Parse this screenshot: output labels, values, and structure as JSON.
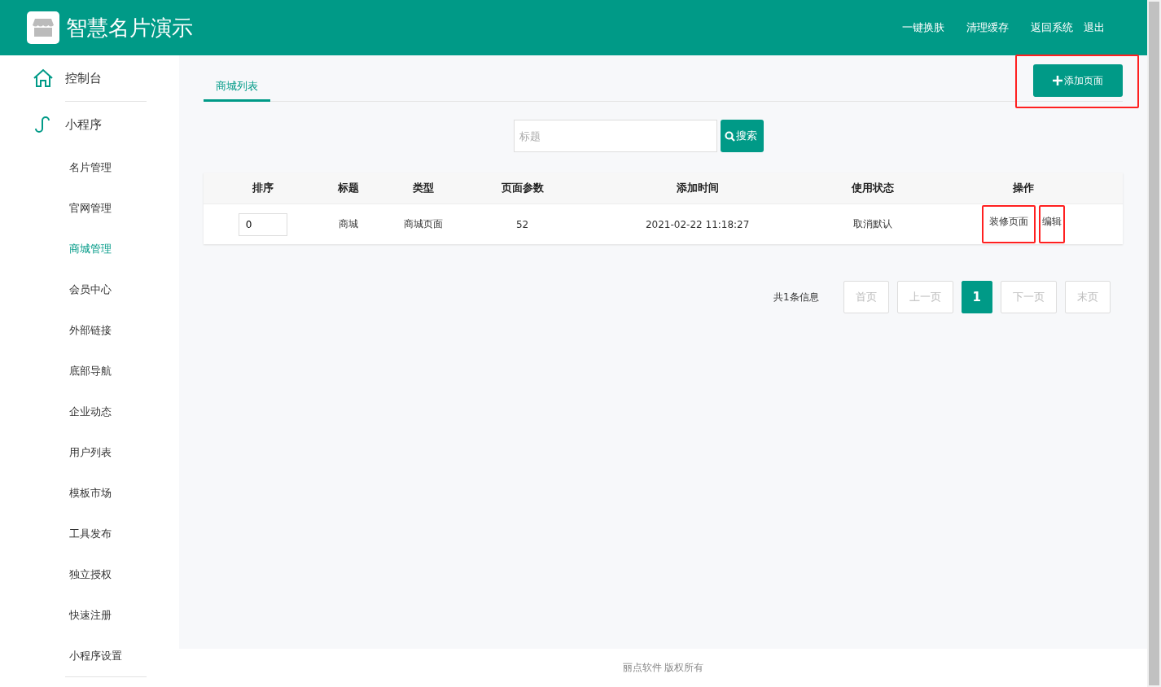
{
  "header": {
    "title": "智慧名片演示",
    "links": [
      "一键换肤",
      "清理缓存",
      "返回系统",
      "退出"
    ]
  },
  "sidebar": {
    "sections": [
      {
        "label": "控制台",
        "kind": "home"
      },
      {
        "label": "小程序",
        "kind": "app",
        "children": [
          {
            "label": "名片管理",
            "selected": false
          },
          {
            "label": "官网管理",
            "selected": false
          },
          {
            "label": "商城管理",
            "selected": true
          },
          {
            "label": "会员中心",
            "selected": false
          },
          {
            "label": "外部链接",
            "selected": false
          },
          {
            "label": "底部导航",
            "selected": false
          },
          {
            "label": "企业动态",
            "selected": false
          },
          {
            "label": "用户列表",
            "selected": false
          },
          {
            "label": "模板市场",
            "selected": false
          },
          {
            "label": "工具发布",
            "selected": false
          },
          {
            "label": "独立授权",
            "selected": false
          },
          {
            "label": "快速注册",
            "selected": false
          },
          {
            "label": "小程序设置",
            "selected": false
          }
        ]
      }
    ]
  },
  "tabs": [
    {
      "label": "商城列表",
      "selected": true
    }
  ],
  "add_button": {
    "label": "添加页面",
    "highlighted": true
  },
  "search": {
    "placeholder": "标题",
    "button": "搜索"
  },
  "table": {
    "columns": [
      "排序",
      "标题",
      "类型",
      "页面参数",
      "添加时间",
      "使用状态",
      "操作"
    ],
    "rows": [
      {
        "sort": "0",
        "title": "商城",
        "type": "商城页面",
        "params": "52",
        "time": "2021-02-22 11:18:27",
        "status": "取消默认",
        "actions": [
          {
            "label": "装修页面",
            "highlighted": true
          },
          {
            "label": "编辑",
            "highlighted": true
          }
        ]
      }
    ]
  },
  "pagination": {
    "summary": "共1条信息",
    "buttons": [
      {
        "label": "首页",
        "selected": false
      },
      {
        "label": "上一页",
        "selected": false
      },
      {
        "label": "1",
        "selected": true
      },
      {
        "label": "下一页",
        "selected": false
      },
      {
        "label": "末页",
        "selected": false
      }
    ]
  },
  "footer": "丽点软件 版权所有"
}
